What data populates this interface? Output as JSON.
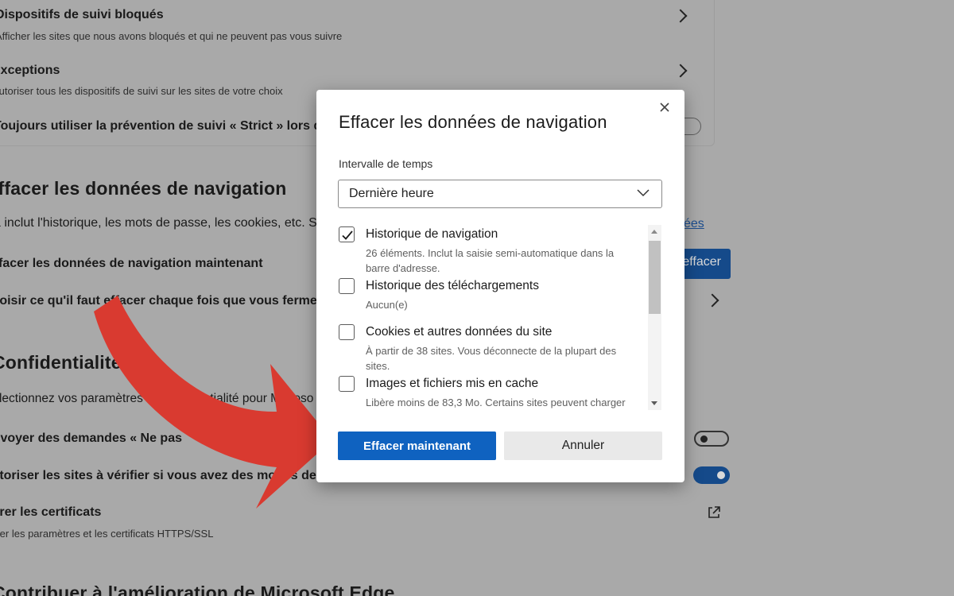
{
  "background": {
    "tracking_blocked": {
      "title": "Dispositifs de suivi bloqués",
      "subtitle": "Afficher les sites que nous avons bloqués et qui ne peuvent pas vous suivre"
    },
    "exceptions": {
      "title": "Exceptions",
      "subtitle": "Autoriser tous les dispositifs de suivi sur les sites de votre choix"
    },
    "strict_row": {
      "title": "Toujours utiliser la prévention de suivi « Strict » lors de l"
    },
    "clear_section": {
      "heading": "Effacer les données de navigation",
      "description": "Cela inclut l'historique, les mots de passe, les cookies, etc. Se",
      "link_fragment": "ées",
      "clear_now_label": "Effacer les données de navigation maintenant",
      "clear_button_fragment": "effacer",
      "choose_label": "Choisir ce qu'il faut effacer chaque fois que vous fermez le"
    },
    "privacy_section": {
      "heading": "Confidentialité",
      "description": "Sélectionnez vos paramètres de confidentialité pour Microso",
      "dnt_label": "Envoyer des demandes « Ne pas",
      "payment_label": "Autoriser les sites à vérifier si vous avez des modes de paie",
      "certs_title": "Gérer les certificats",
      "certs_subtitle": "Gérer les paramètres et les certificats HTTPS/SSL"
    },
    "improve_heading": "Contribuer à l'amélioration de Microsoft Edge"
  },
  "dialog": {
    "title": "Effacer les données de navigation",
    "time_range_label": "Intervalle de temps",
    "time_range_value": "Dernière heure",
    "items": [
      {
        "title": "Historique de navigation",
        "description": "26 éléments. Inclut la saisie semi-automatique dans la barre d'adresse.",
        "checked": true
      },
      {
        "title": "Historique des téléchargements",
        "description": "Aucun(e)",
        "checked": false
      },
      {
        "title": "Cookies et autres données du site",
        "description": "À partir de 38 sites. Vous déconnecte de la plupart des sites.",
        "checked": false
      },
      {
        "title": "Images et fichiers mis en cache",
        "description": "Libère moins de 83,3 Mo. Certains sites peuvent charger",
        "checked": false
      }
    ],
    "primary_button": "Effacer maintenant",
    "secondary_button": "Annuler"
  },
  "colors": {
    "overlay_background": "#a9a9a9",
    "primary_blue": "#0f62c0",
    "arrow_red": "#d93a30"
  },
  "icons": {
    "close": "close-icon",
    "dropdown": "chevron-down-icon",
    "check": "check-icon",
    "arrow": "curved-arrow-icon"
  }
}
